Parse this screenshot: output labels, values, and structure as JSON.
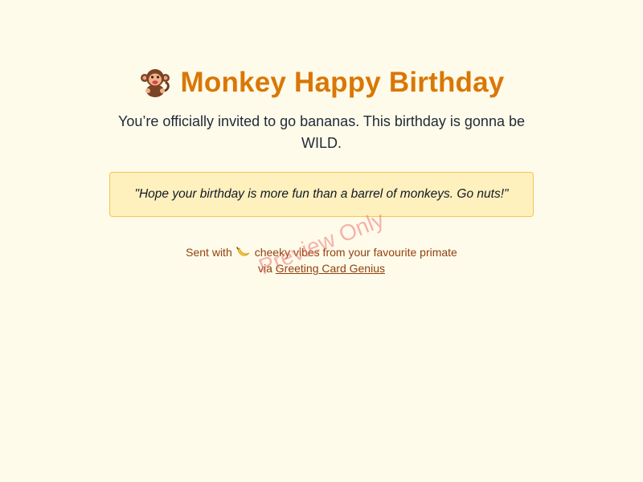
{
  "card": {
    "icon": "monkey-icon",
    "title": "Monkey Happy Birthday",
    "tagline": "You’re officially invited to go bananas. This birthday is gonna be WILD.",
    "quote": "\"Hope your birthday is more fun than a barrel of monkeys. Go nuts!\""
  },
  "footer": {
    "sent_prefix": "Sent with",
    "sent_icon": "banana-icon",
    "sent_suffix": "cheeky vibes from your favourite primate",
    "via_prefix": "via",
    "via_link": "Greeting Card Genius"
  },
  "watermark": "Preview Only",
  "colors": {
    "background": "#fffbea",
    "title": "#d97706",
    "quote_bg": "#fff1bd",
    "quote_border": "#f4c64f",
    "footer_text": "#92400e",
    "watermark": "#eb7878"
  }
}
